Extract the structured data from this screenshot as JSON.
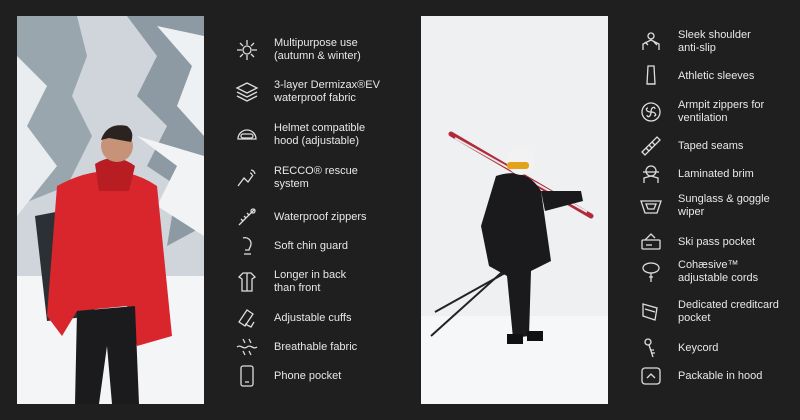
{
  "left_features": [
    {
      "label": "Multipurpose use\n(autumn & winter)",
      "icon": "sun-snowflake-icon"
    },
    {
      "label": "3-layer Dermizax®EV\nwaterproof fabric",
      "icon": "fabric-layers-icon"
    },
    {
      "label": "Helmet compatible\nhood (adjustable)",
      "icon": "helmet-icon"
    },
    {
      "label": "RECCO® rescue\nsystem",
      "icon": "recco-signal-icon"
    },
    {
      "label": "Waterproof zippers",
      "icon": "zipper-icon"
    },
    {
      "label": "Soft chin guard",
      "icon": "chin-guard-icon"
    },
    {
      "label": "Longer in back\nthan front",
      "icon": "jacket-back-icon"
    },
    {
      "label": "Adjustable cuffs",
      "icon": "cuff-icon"
    },
    {
      "label": "Breathable fabric",
      "icon": "breathable-fabric-icon"
    },
    {
      "label": "Phone pocket",
      "icon": "phone-icon"
    }
  ],
  "right_features": [
    {
      "label": "Sleek shoulder\nanti-slip",
      "icon": "shoulder-anti-slip-icon"
    },
    {
      "label": "Athletic sleeves",
      "icon": "sleeve-icon"
    },
    {
      "label": "Armpit zippers for\nventilation",
      "icon": "fan-icon"
    },
    {
      "label": "Taped seams",
      "icon": "taped-seams-icon"
    },
    {
      "label": "Laminated brim",
      "icon": "brim-icon"
    },
    {
      "label": "Sunglass & goggle\nwiper",
      "icon": "goggle-wiper-icon"
    },
    {
      "label": "Ski pass pocket",
      "icon": "ski-pass-icon"
    },
    {
      "label": "Cohæsive™\nadjustable cords",
      "icon": "cord-adjuster-icon"
    },
    {
      "label": "Dedicated creditcard\npocket",
      "icon": "creditcard-icon"
    },
    {
      "label": "Keycord",
      "icon": "key-icon"
    },
    {
      "label": "Packable in hood",
      "icon": "packable-hood-icon"
    }
  ],
  "colors": {
    "background": "#1f1f1f",
    "text": "#e8e8e8",
    "jacket_red": "#d9262c",
    "snow": "#f2f4f6"
  }
}
